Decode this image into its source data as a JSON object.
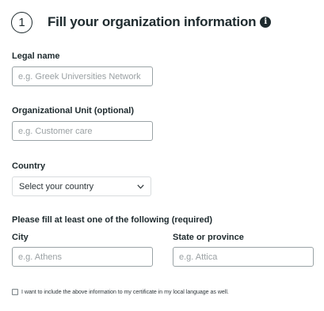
{
  "header": {
    "step_number": "1",
    "title": "Fill your organization information",
    "info_icon": "info-icon"
  },
  "form": {
    "legal_name": {
      "label": "Legal name",
      "placeholder": "e.g. Greek Universities Network",
      "value": ""
    },
    "org_unit": {
      "label": "Organizational Unit (optional)",
      "placeholder": "e.g. Customer care",
      "value": ""
    },
    "country": {
      "label": "Country",
      "selected": "Select your country",
      "icon": "chevron-down-icon"
    },
    "location_note": "Please fill at least one of the following (required)",
    "city": {
      "label": "City",
      "placeholder": "e.g. Athens",
      "value": ""
    },
    "state": {
      "label": "State or province",
      "placeholder": "e.g. Attica",
      "value": ""
    },
    "local_language": {
      "checked": false,
      "label": "I want to include the above information to my certificate in my local language as well."
    }
  }
}
